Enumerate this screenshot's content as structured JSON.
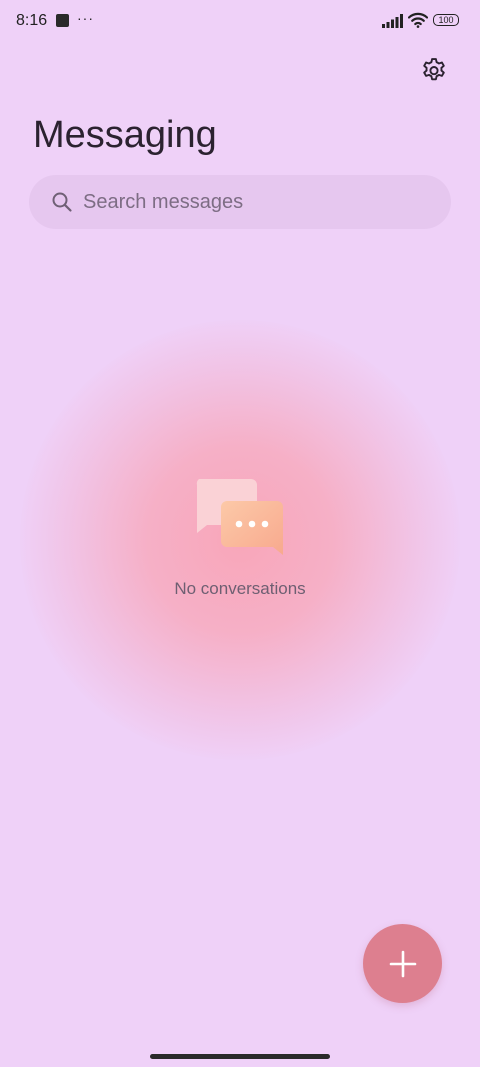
{
  "status_bar": {
    "time": "8:16",
    "more": "···",
    "battery": "100"
  },
  "header": {
    "title": "Messaging",
    "settings_icon": "gear-icon"
  },
  "search": {
    "placeholder": "Search messages",
    "value": ""
  },
  "empty_state": {
    "text": "No conversations",
    "icon": "chat-bubbles-icon"
  },
  "fab": {
    "icon": "plus-icon"
  },
  "colors": {
    "background": "#efd1f8",
    "search_background": "#e6c7ef",
    "fab": "#dd7f8f",
    "glow": "#f9a4b6"
  }
}
